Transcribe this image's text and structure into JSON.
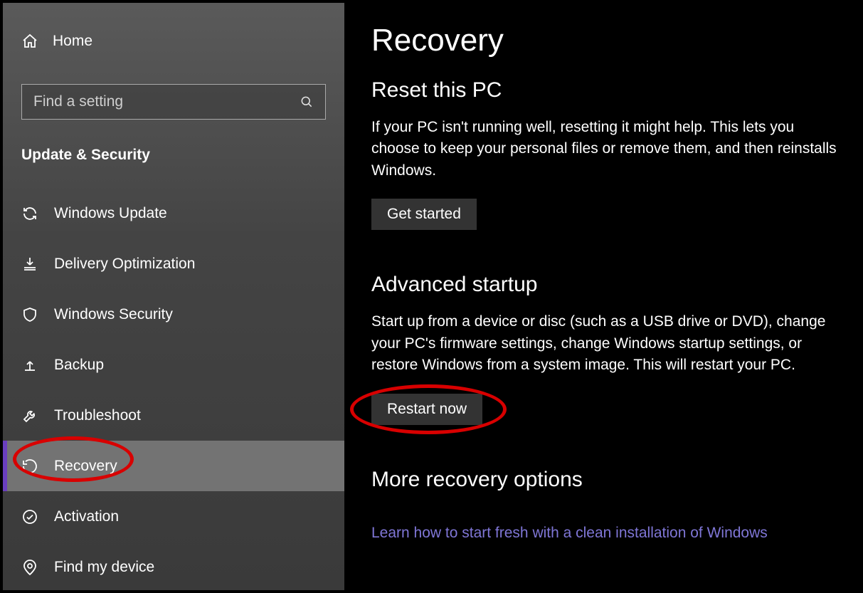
{
  "sidebar": {
    "home_label": "Home",
    "search_placeholder": "Find a setting",
    "category": "Update & Security",
    "items": [
      {
        "label": "Windows Update"
      },
      {
        "label": "Delivery Optimization"
      },
      {
        "label": "Windows Security"
      },
      {
        "label": "Backup"
      },
      {
        "label": "Troubleshoot"
      },
      {
        "label": "Recovery"
      },
      {
        "label": "Activation"
      },
      {
        "label": "Find my device"
      }
    ],
    "selected_index": 5
  },
  "main": {
    "title": "Recovery",
    "sections": {
      "reset": {
        "heading": "Reset this PC",
        "body": "If your PC isn't running well, resetting it might help. This lets you choose to keep your personal files or remove them, and then reinstalls Windows.",
        "button": "Get started"
      },
      "advanced": {
        "heading": "Advanced startup",
        "body": "Start up from a device or disc (such as a USB drive or DVD), change your PC's firmware settings, change Windows startup settings, or restore Windows from a system image. This will restart your PC.",
        "button": "Restart now"
      },
      "more": {
        "heading": "More recovery options",
        "link": "Learn how to start fresh with a clean installation of Windows"
      }
    }
  }
}
